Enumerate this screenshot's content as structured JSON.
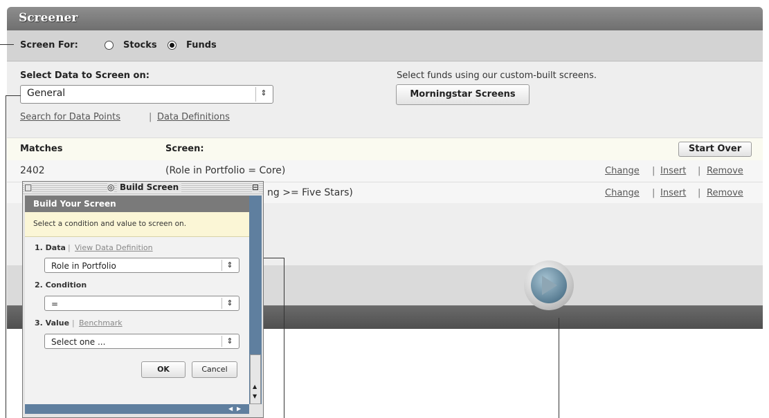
{
  "screener": {
    "title": "Screener",
    "screen_for_label": "Screen For:",
    "options": [
      {
        "label": "Stocks",
        "selected": false
      },
      {
        "label": "Funds",
        "selected": true
      }
    ],
    "select_data_label": "Select Data to Screen on:",
    "data_select_value": "General",
    "links": {
      "search": "Search for Data Points",
      "definitions": "Data Definitions",
      "separator": "|"
    },
    "custom_screens_text": "Select funds using our custom-built screens.",
    "morningstar_button": "Morningstar Screens",
    "matches_header": "Matches",
    "screen_header": "Screen:",
    "start_over_button": "Start Over",
    "rows": [
      {
        "matches": "2402",
        "condition": "(Role in Portfolio = Core)"
      },
      {
        "matches": "",
        "condition": "ng >= Five Stars)"
      }
    ],
    "row_actions": {
      "change": "Change",
      "insert": "Insert",
      "remove": "Remove",
      "separator": "|"
    }
  },
  "dialog": {
    "window_title": "Build Screen",
    "header": "Build Your Screen",
    "instruction": "Select a condition and value to screen on.",
    "data_label": "1. Data",
    "data_link": "View Data Definition",
    "data_value": "Role in Portfolio",
    "condition_label": "2. Condition",
    "condition_value": "=",
    "value_label": "3. Value",
    "value_link": "Benchmark",
    "value_placeholder": "Select one ...",
    "ok_button": "OK",
    "cancel_button": "Cancel",
    "separator": "|"
  },
  "icons": {
    "window_close": "□",
    "window_menu": "◎",
    "window_maximize": "⊟",
    "select_arrow": "⇕",
    "scroll_up": "▲",
    "scroll_down": "▼",
    "scroll_left": "◀",
    "scroll_right": "▶",
    "run": "play-icon"
  },
  "colors": {
    "title_bar": "#7b7b7b",
    "dialog_scroll": "#5f7f9f",
    "run_button": "#5a7e94"
  }
}
